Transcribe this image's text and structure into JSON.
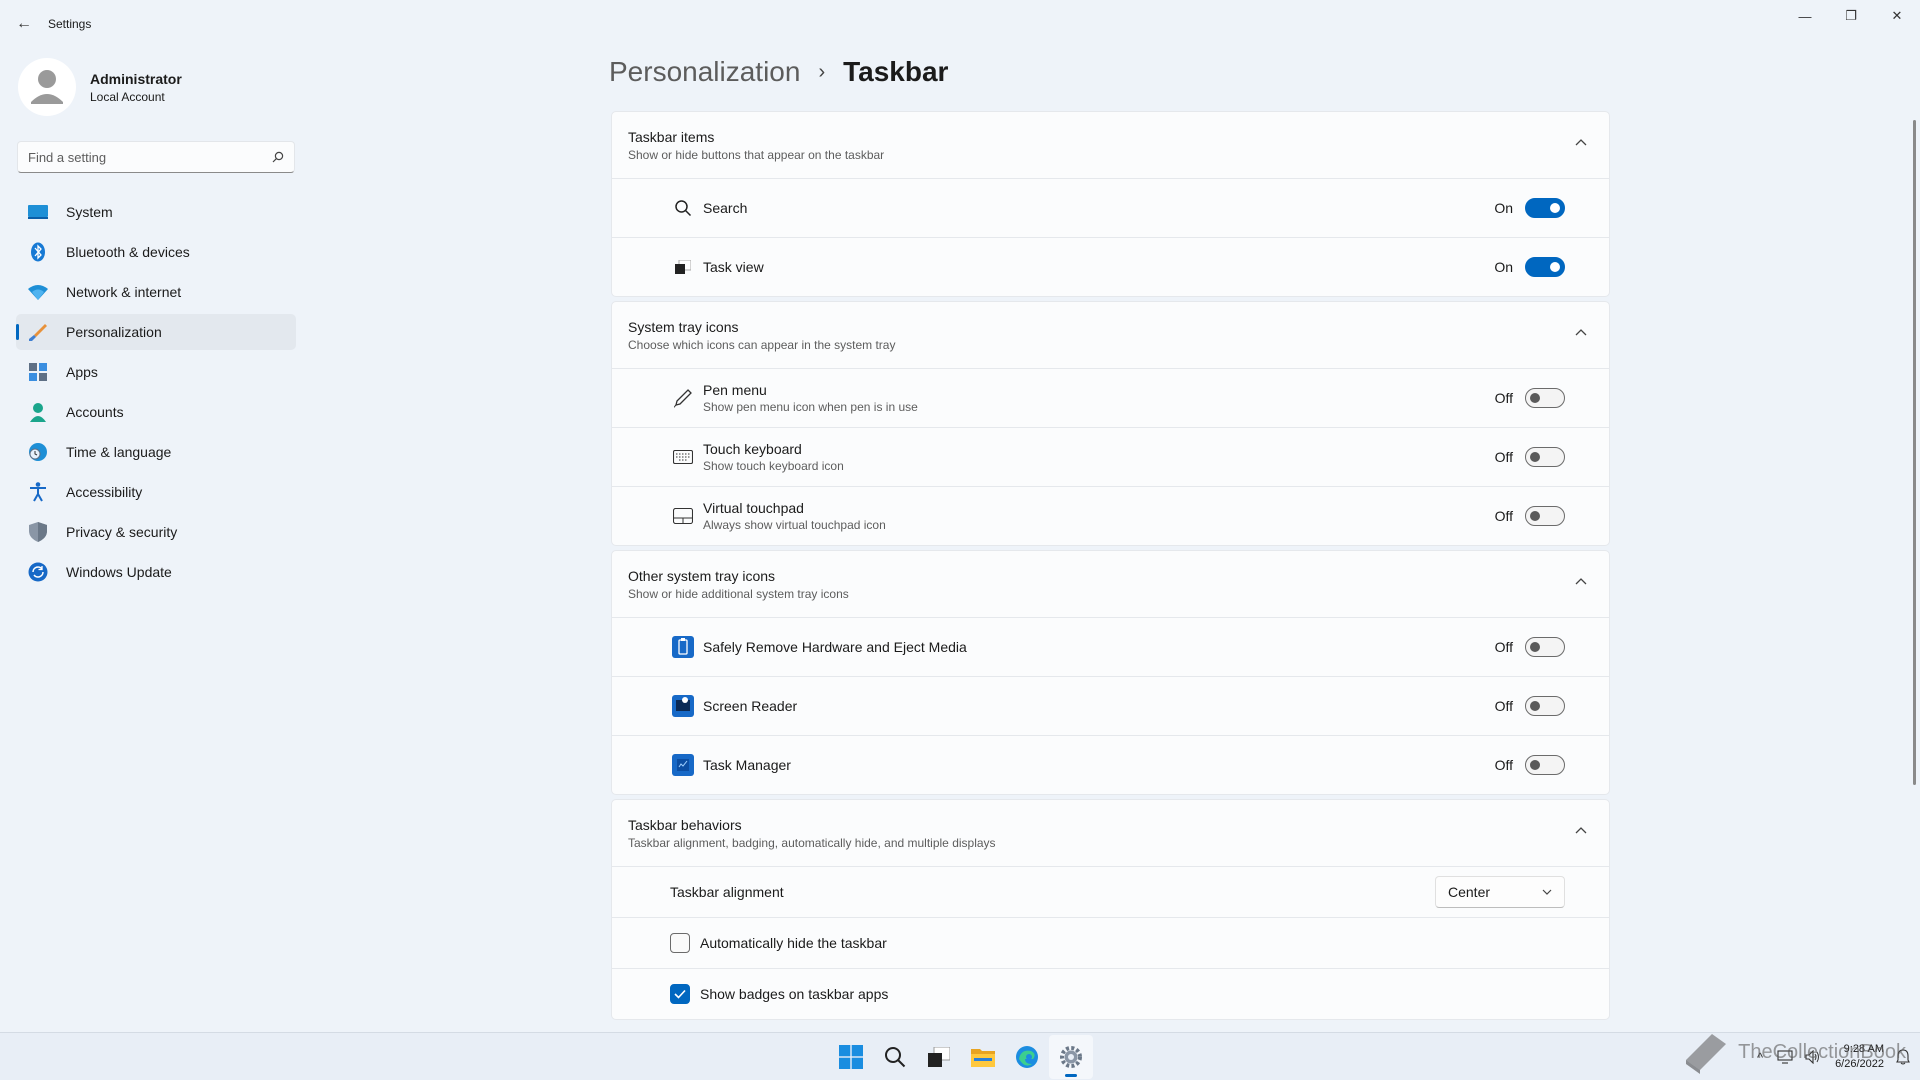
{
  "window": {
    "title": "Settings",
    "back_glyph": "←",
    "minimize_glyph": "—",
    "maximize_glyph": "❐",
    "close_glyph": "✕"
  },
  "profile": {
    "name": "Administrator",
    "account_type": "Local Account"
  },
  "search": {
    "placeholder": "Find a setting",
    "icon": "search-icon"
  },
  "sidebar": {
    "items": [
      {
        "label": "System",
        "icon": "system-display-icon",
        "active": false
      },
      {
        "label": "Bluetooth & devices",
        "icon": "bluetooth-icon",
        "active": false
      },
      {
        "label": "Network & internet",
        "icon": "wifi-icon",
        "active": false
      },
      {
        "label": "Personalization",
        "icon": "brush-icon",
        "active": true
      },
      {
        "label": "Apps",
        "icon": "apps-icon",
        "active": false
      },
      {
        "label": "Accounts",
        "icon": "person-icon",
        "active": false
      },
      {
        "label": "Time & language",
        "icon": "globe-clock-icon",
        "active": false
      },
      {
        "label": "Accessibility",
        "icon": "accessibility-icon",
        "active": false
      },
      {
        "label": "Privacy & security",
        "icon": "shield-icon",
        "active": false
      },
      {
        "label": "Windows Update",
        "icon": "update-icon",
        "active": false
      }
    ]
  },
  "breadcrumb": {
    "parent": "Personalization",
    "separator": "›",
    "current": "Taskbar"
  },
  "groups": {
    "taskbar_items": {
      "title": "Taskbar items",
      "subtitle": "Show or hide buttons that appear on the taskbar",
      "rows": {
        "search": {
          "label": "Search",
          "state": "On"
        },
        "task_view": {
          "label": "Task view",
          "state": "On"
        }
      }
    },
    "system_tray": {
      "title": "System tray icons",
      "subtitle": "Choose which icons can appear in the system tray",
      "rows": {
        "pen_menu": {
          "label": "Pen menu",
          "sub": "Show pen menu icon when pen is in use",
          "state": "Off"
        },
        "touch_keyboard": {
          "label": "Touch keyboard",
          "sub": "Show touch keyboard icon",
          "state": "Off"
        },
        "virtual_touchpad": {
          "label": "Virtual touchpad",
          "sub": "Always show virtual touchpad icon",
          "state": "Off"
        }
      }
    },
    "other_tray": {
      "title": "Other system tray icons",
      "subtitle": "Show or hide additional system tray icons",
      "rows": {
        "safely_remove": {
          "label": "Safely Remove Hardware and Eject Media",
          "state": "Off"
        },
        "screen_reader": {
          "label": "Screen Reader",
          "state": "Off"
        },
        "task_manager": {
          "label": "Task Manager",
          "state": "Off"
        }
      }
    },
    "behaviors": {
      "title": "Taskbar behaviors",
      "subtitle": "Taskbar alignment, badging, automatically hide, and multiple displays",
      "alignment": {
        "label": "Taskbar alignment",
        "value": "Center"
      },
      "auto_hide": {
        "label": "Automatically hide the taskbar",
        "checked": false
      },
      "badges": {
        "label": "Show badges on taskbar apps",
        "checked": true
      }
    }
  },
  "taskbar": {
    "icons": [
      "windows-start-icon",
      "search-icon",
      "task-view-icon",
      "file-explorer-icon",
      "edge-browser-icon",
      "settings-gear-icon"
    ],
    "active": "settings-gear-icon",
    "tray_chevron": "^",
    "time": "9:28 AM",
    "date": "6/26/2022"
  },
  "watermark": {
    "text": "TheCollectionBook"
  },
  "colors": {
    "accent": "#0067c0",
    "background": "#eef3f9",
    "card": "#fbfcfd"
  }
}
